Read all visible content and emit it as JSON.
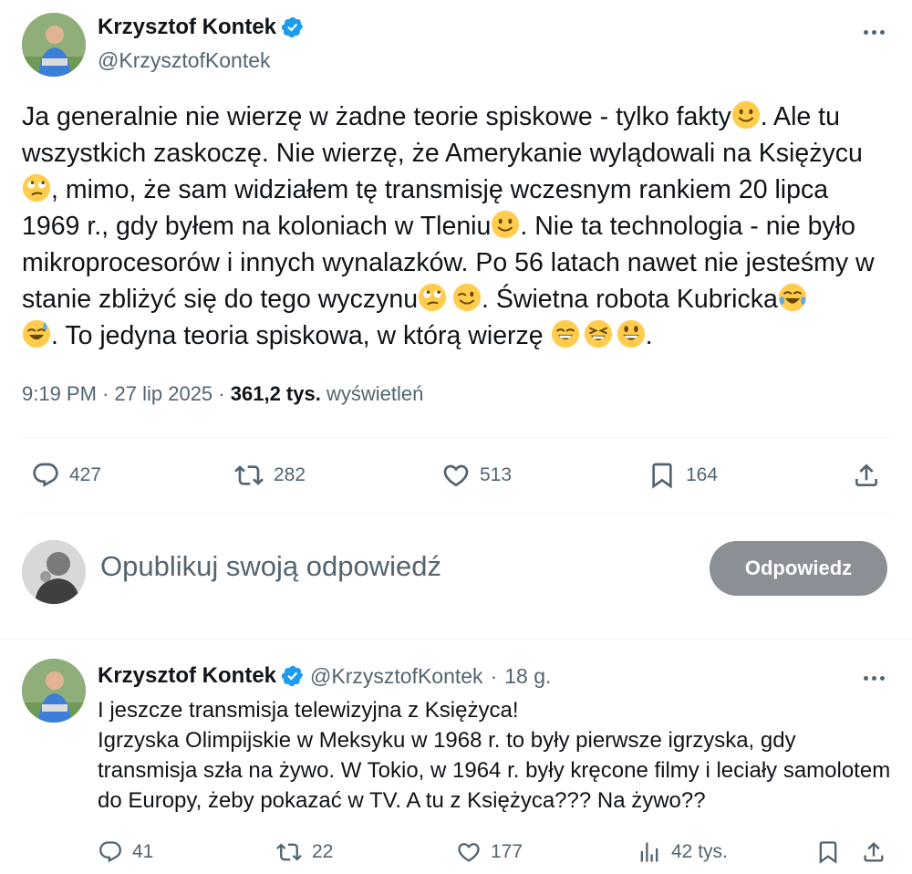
{
  "main_tweet": {
    "author_name": "Krzysztof Kontek",
    "handle": "@KrzysztofKontek",
    "text_parts": [
      "Ja generalnie nie wierzę w żadne teorie spiskowe - tylko fakty",
      ". Ale tu wszystkich zaskoczę. Nie wierzę, że Amerykanie wylądowali na Księżycu ",
      ", mimo, że sam widziałem tę transmisję wczesnym rankiem 20 lipca 1969 r., gdy byłem na koloniach w Tleniu",
      ". Nie ta technologia - nie było mikroprocesorów i innych wynalazków. Po 56 latach nawet nie jesteśmy w stanie zbliżyć się do tego wyczynu",
      ". Świetna robota Kubricka",
      ". To jedyna teoria spiskowa, w którą wierzę ",
      "."
    ],
    "time": "9:19 PM",
    "date": "27 lip 2025",
    "separator": "·",
    "views_count": "361,2 tys.",
    "views_label": "wyświetleń",
    "stats": {
      "replies": "427",
      "reposts": "282",
      "likes": "513",
      "bookmarks": "164"
    }
  },
  "reply_box": {
    "placeholder": "Opublikuj swoją odpowiedź",
    "button_label": "Odpowiedz"
  },
  "second_tweet": {
    "author_name": "Krzysztof Kontek",
    "handle": "@KrzysztofKontek",
    "separator": "·",
    "time_ago": "18 g.",
    "lines": [
      "I jeszcze transmisja telewizyjna z Księżyca!",
      "Igrzyska Olimpijskie w Meksyku w 1968 r. to były pierwsze igrzyska, gdy transmisja szła na żywo. W Tokio, w 1964 r. były kręcone filmy i leciały samolotem do Europy, żeby pokazać w TV. A tu z Księżyca??? Na żywo??"
    ],
    "stats": {
      "replies": "41",
      "reposts": "22",
      "likes": "177",
      "views": "42 tys."
    }
  },
  "colors": {
    "accent_blue": "#1d9bf0",
    "text_primary": "#0f1419",
    "text_secondary": "#536471",
    "button_disabled": "#8b9096",
    "emoji_yellow": "#ffcc4d"
  }
}
